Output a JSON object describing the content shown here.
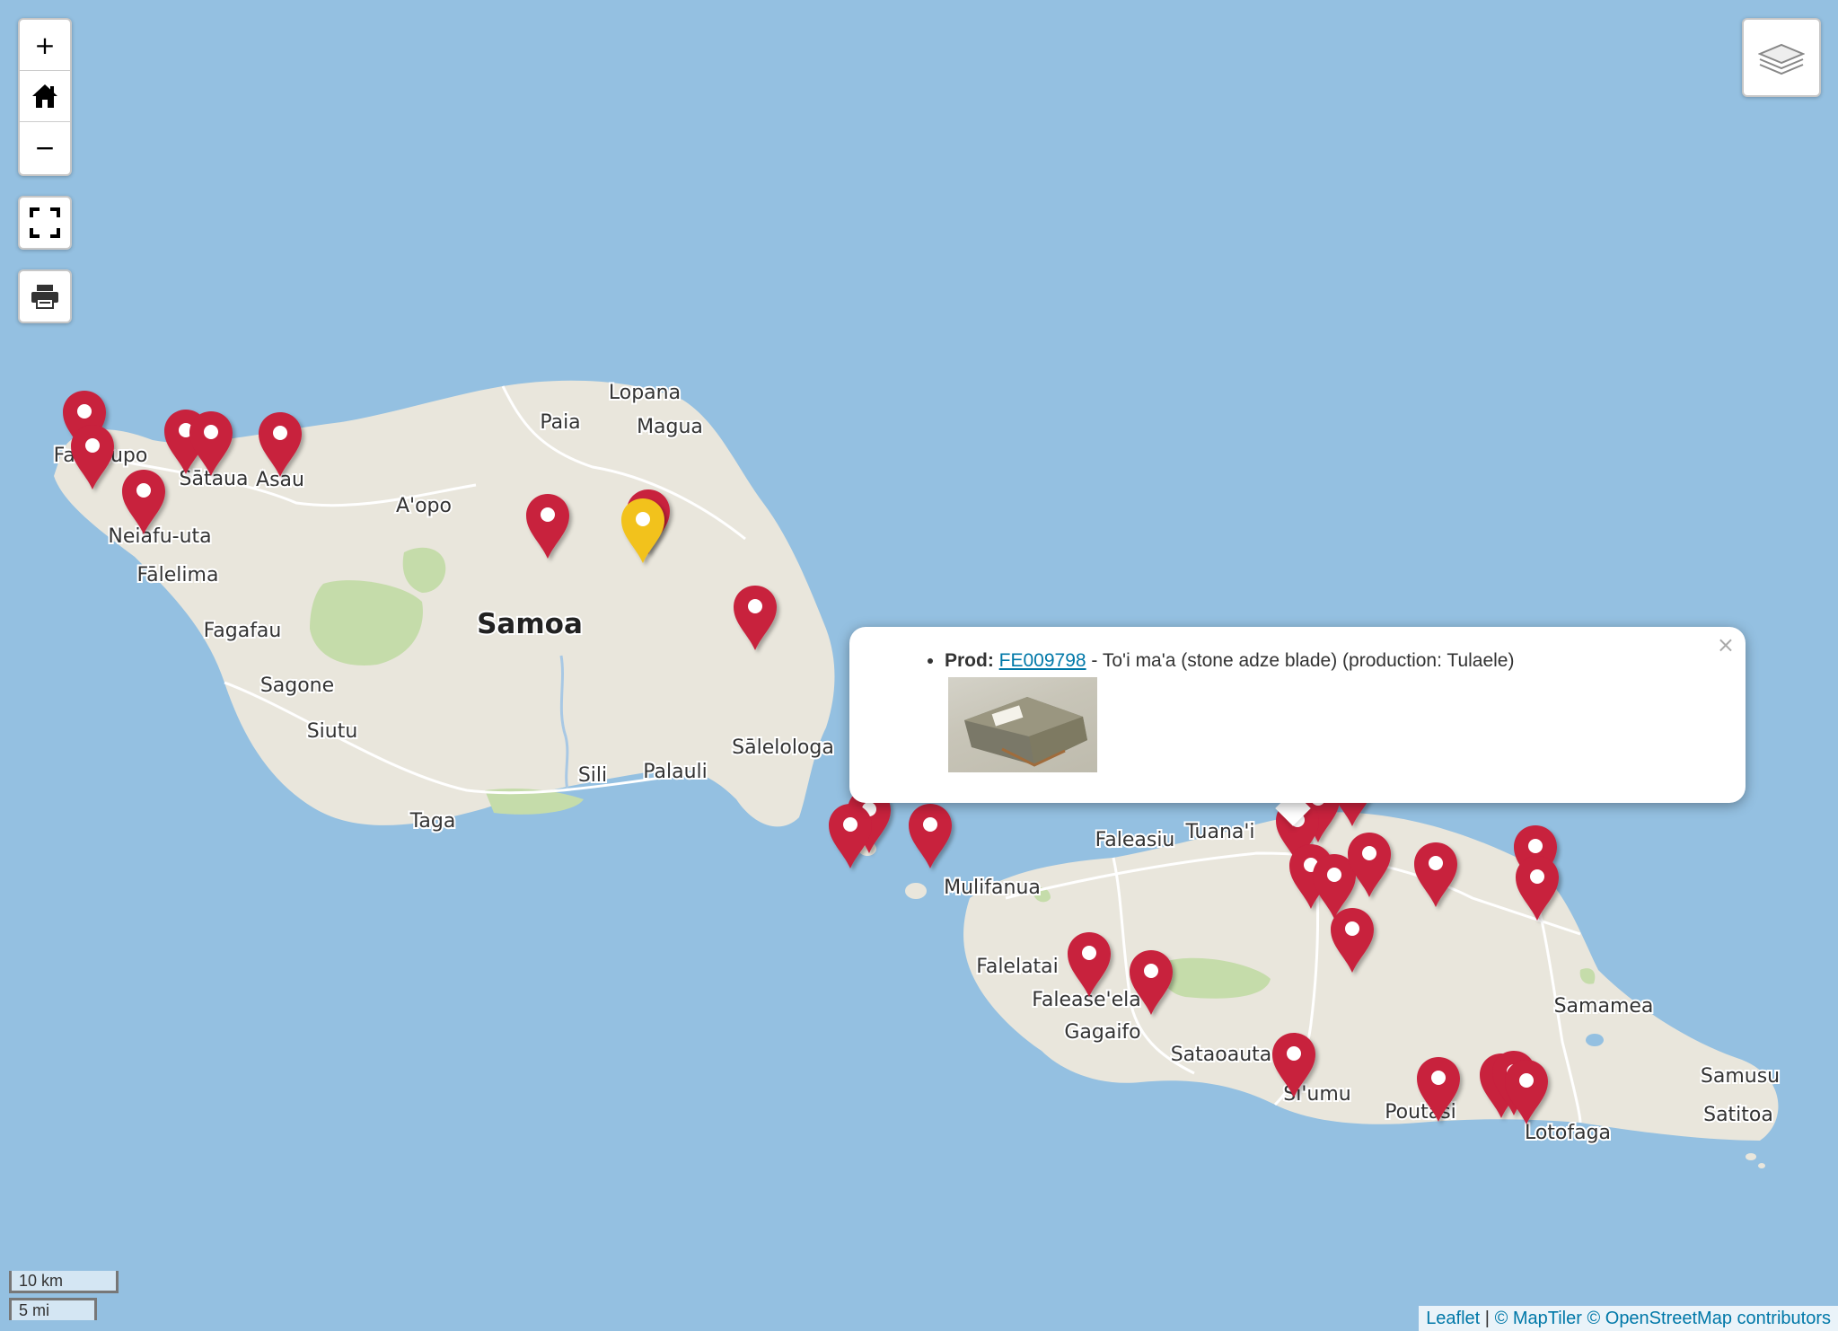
{
  "controls": {
    "zoom_in": "+",
    "zoom_out": "−",
    "home_icon": "home-icon",
    "fullscreen_icon": "fullscreen-icon",
    "print_icon": "print-icon",
    "layers_icon": "layers-icon"
  },
  "map": {
    "labels": {
      "samoa": "Samoa",
      "lopana": "Lopana",
      "paia": "Paia",
      "magua": "Magua",
      "falealupo": "Falealupo",
      "sataua": "Sātaua",
      "asau": "Asau",
      "aopo": "A'opo",
      "neiafu_uta": "Neiafu-uta",
      "falelima": "Fālelima",
      "fagafau": "Fagafau",
      "sagone": "Sagone",
      "siutu": "Siutu",
      "taga": "Taga",
      "sili": "Sili",
      "palauli": "Palauli",
      "salelologa": "Sālelologa",
      "faleasiu": "Faleasiu",
      "tuanai": "Tuana'i",
      "mulifanua": "Mulifanua",
      "falelatai": "Falelatai",
      "faleaseela": "Falease'ela",
      "gagaifo": "Gagaifo",
      "sataoauta": "Sataoauta",
      "siumu": "Si'umu",
      "poutasi": "Poutasi",
      "lotofaga": "Lotofaga",
      "samamea": "Samamea",
      "samusu": "Samusu",
      "satitoa": "Satitoa"
    },
    "colors": {
      "sea": "#94c0e1",
      "land": "#e9e6dc",
      "park": "#c5dcaa",
      "marker": "#c8203e",
      "marker_selected": "#f2c21b"
    }
  },
  "popup": {
    "prefix": "Prod:",
    "link_text": "FE009798",
    "description": " - To'i ma'a (stone adze blade) (production: Tulaele)",
    "close": "×"
  },
  "scale": {
    "km": "10 km",
    "mi": "5 mi"
  },
  "attribution": {
    "leaflet": "Leaflet",
    "separator": " | ",
    "copyright": "© MapTiler © OpenStreetMap contributors"
  }
}
